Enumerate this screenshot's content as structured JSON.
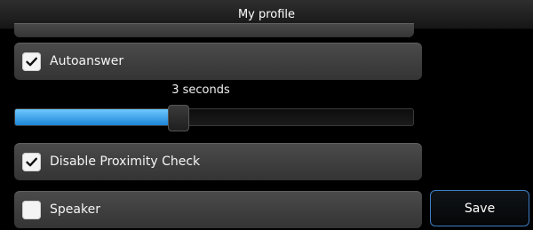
{
  "header": {
    "title": "My profile"
  },
  "settings": {
    "autoanswer": {
      "label": "Autoanswer",
      "checked": true
    },
    "delay": {
      "value_text": "3 seconds",
      "fill_fraction": 0.41
    },
    "disable_proximity": {
      "label": "Disable Proximity Check",
      "checked": true
    },
    "speaker": {
      "label": "Speaker",
      "checked": false
    }
  },
  "actions": {
    "save_label": "Save"
  },
  "colors": {
    "accent": "#1d86d8",
    "button_border": "#3d7fc4"
  },
  "icons": {
    "check": "check-icon"
  }
}
